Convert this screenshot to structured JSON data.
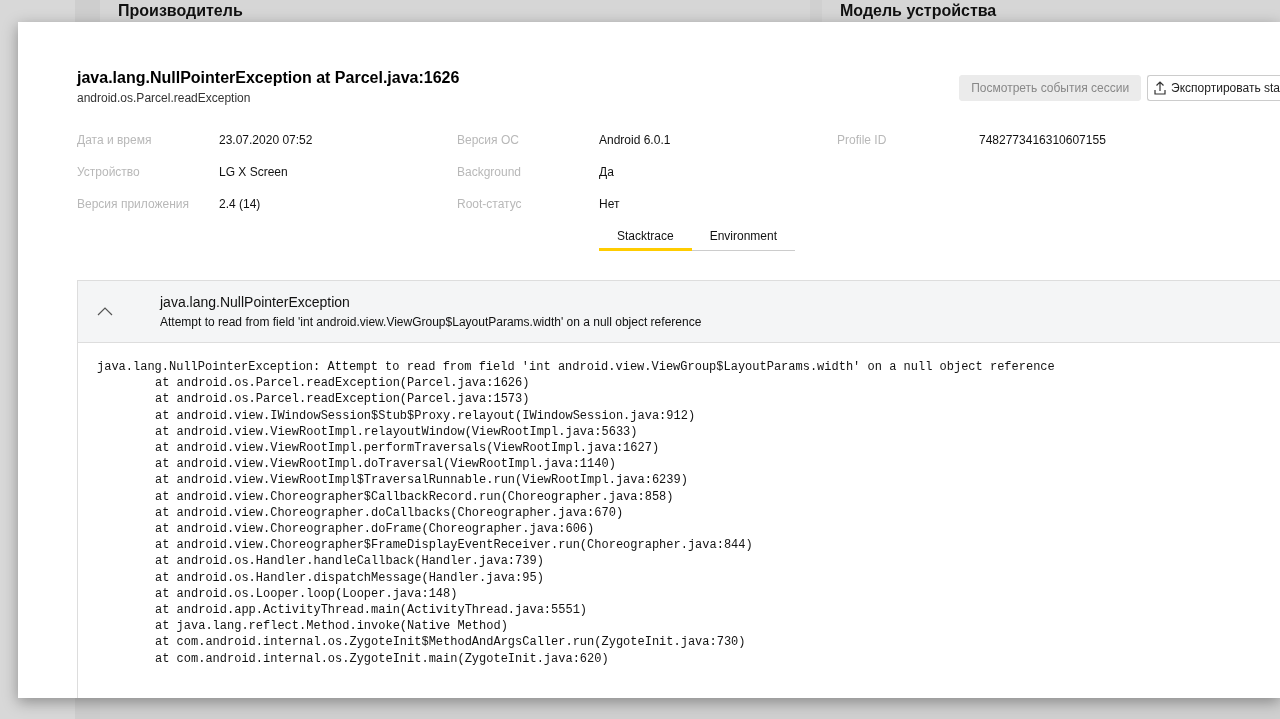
{
  "background": {
    "cards": [
      {
        "heading": "Производитель"
      },
      {
        "heading": "Модель устройства"
      }
    ]
  },
  "crash": {
    "title": "java.lang.NullPointerException at Parcel.java:1626",
    "subtitle": "android.os.Parcel.readException",
    "actions": [
      {
        "label": "Посмотреть события сессии",
        "kind": "plain",
        "disabled": true
      },
      {
        "label": "Экспортировать sta",
        "kind": "export",
        "disabled": false
      }
    ],
    "details": [
      {
        "label": "Дата и время",
        "value": "23.07.2020 07:52"
      },
      {
        "label": "Версия ОС",
        "value": "Android 6.0.1"
      },
      {
        "label": "Profile ID",
        "value": "7482773416310607155"
      },
      {
        "label": "Устройство",
        "value": "LG X Screen"
      },
      {
        "label": "Background",
        "value": "Да"
      },
      {
        "label": "Версия приложения",
        "value": "2.4 (14)"
      },
      {
        "label": "Root-статус",
        "value": "Нет"
      }
    ],
    "tabs": [
      {
        "label": "Stacktrace",
        "selected": true
      },
      {
        "label": "Environment",
        "selected": false
      }
    ],
    "exception": {
      "expanded": true,
      "name": "java.lang.NullPointerException",
      "message": "Attempt to read from field 'int android.view.ViewGroup$LayoutParams.width' on a null object reference",
      "trace_head": "java.lang.NullPointerException: Attempt to read from field 'int android.view.ViewGroup$LayoutParams.width' on a null object reference",
      "frames": [
        "at android.os.Parcel.readException(Parcel.java:1626)",
        "at android.os.Parcel.readException(Parcel.java:1573)",
        "at android.view.IWindowSession$Stub$Proxy.relayout(IWindowSession.java:912)",
        "at android.view.ViewRootImpl.relayoutWindow(ViewRootImpl.java:5633)",
        "at android.view.ViewRootImpl.performTraversals(ViewRootImpl.java:1627)",
        "at android.view.ViewRootImpl.doTraversal(ViewRootImpl.java:1140)",
        "at android.view.ViewRootImpl$TraversalRunnable.run(ViewRootImpl.java:6239)",
        "at android.view.Choreographer$CallbackRecord.run(Choreographer.java:858)",
        "at android.view.Choreographer.doCallbacks(Choreographer.java:670)",
        "at android.view.Choreographer.doFrame(Choreographer.java:606)",
        "at android.view.Choreographer$FrameDisplayEventReceiver.run(Choreographer.java:844)",
        "at android.os.Handler.handleCallback(Handler.java:739)",
        "at android.os.Handler.dispatchMessage(Handler.java:95)",
        "at android.os.Looper.loop(Looper.java:148)",
        "at android.app.ActivityThread.main(ActivityThread.java:5551)",
        "at java.lang.reflect.Method.invoke(Native Method)",
        "at com.android.internal.os.ZygoteInit$MethodAndArgsCaller.run(ZygoteInit.java:730)",
        "at com.android.internal.os.ZygoteInit.main(ZygoteInit.java:620)"
      ]
    }
  }
}
